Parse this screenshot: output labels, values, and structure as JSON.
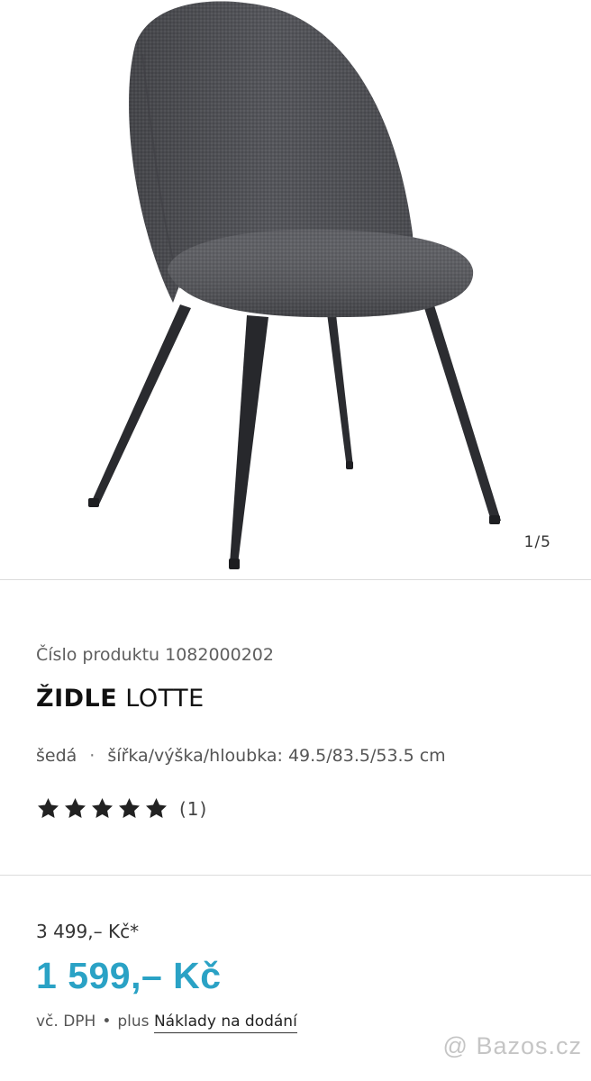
{
  "gallery": {
    "image_alt": "gray upholstered chair",
    "counter": "1/5"
  },
  "product": {
    "number_label": "Číslo produktu 1082000202",
    "title_bold": "ŽIDLE",
    "title_rest": " LOTTE",
    "color": "šedá",
    "separator": "·",
    "dimensions": "šířka/výška/hloubka: 49.5/83.5/53.5 cm",
    "rating": {
      "value": 5,
      "max": 5,
      "count": "(1)"
    }
  },
  "pricing": {
    "old_price": "3 499,– Kč*",
    "price": "1 599,– Kč",
    "vat": "vč. DPH",
    "bullet": "•",
    "plus": "plus",
    "shipping_link": "Náklady na dodání"
  },
  "watermark": "@ Bazos.cz",
  "colors": {
    "accent": "#2aa2c5",
    "divider": "#dcdcdc",
    "chair_fabric": "#56575c"
  }
}
